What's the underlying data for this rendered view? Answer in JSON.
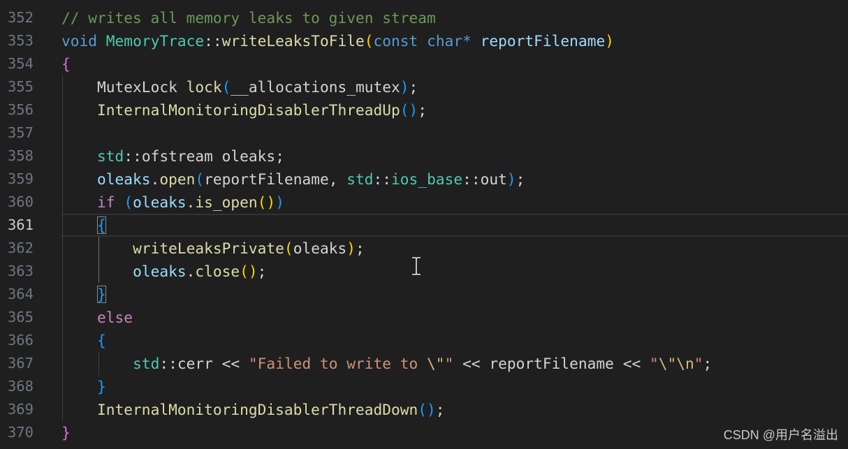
{
  "theme": {
    "background": "#1f1f1f",
    "colors": {
      "comment": "#6a9955",
      "keyword": "#569cd6",
      "control": "#c586c0",
      "type": "#4ec9b0",
      "function": "#dcdcaa",
      "variable": "#9cdcfe",
      "string": "#ce9178",
      "escape": "#d7ba7d",
      "plain": "#d4d4d4",
      "bracket1": "#ffd700",
      "bracket2": "#da70d6",
      "bracket3": "#179fff",
      "linenum": "#6e7681",
      "linenum_active": "#cccccc"
    }
  },
  "editor": {
    "lines": [
      {
        "num": "352",
        "tokens": [
          [
            "// writes all memory leaks to given stream",
            "comment"
          ]
        ]
      },
      {
        "num": "353",
        "tokens": [
          [
            "void",
            "keyword"
          ],
          [
            " ",
            "plain"
          ],
          [
            "MemoryTrace",
            "type"
          ],
          [
            "::",
            "plain"
          ],
          [
            "writeLeaksToFile",
            "function"
          ],
          [
            "(",
            "bracket1"
          ],
          [
            "const",
            "keyword"
          ],
          [
            " ",
            "plain"
          ],
          [
            "char",
            "keyword"
          ],
          [
            "*",
            "keyword"
          ],
          [
            " ",
            "plain"
          ],
          [
            "reportFilename",
            "variable"
          ],
          [
            ")",
            "bracket1"
          ]
        ]
      },
      {
        "num": "354",
        "tokens": [
          [
            "{",
            "bracket2"
          ]
        ]
      },
      {
        "num": "355",
        "tokens": [
          [
            "    ",
            "plain"
          ],
          [
            "MutexLock",
            "plain"
          ],
          [
            " ",
            "plain"
          ],
          [
            "lock",
            "function"
          ],
          [
            "(",
            "bracket3"
          ],
          [
            "__allocations_mutex",
            "plain"
          ],
          [
            ")",
            "bracket3"
          ],
          [
            ";",
            "plain"
          ]
        ]
      },
      {
        "num": "356",
        "tokens": [
          [
            "    ",
            "plain"
          ],
          [
            "InternalMonitoringDisablerThreadUp",
            "function"
          ],
          [
            "()",
            "bracket3"
          ],
          [
            ";",
            "plain"
          ]
        ]
      },
      {
        "num": "357",
        "tokens": []
      },
      {
        "num": "358",
        "tokens": [
          [
            "    ",
            "plain"
          ],
          [
            "std",
            "type"
          ],
          [
            "::",
            "plain"
          ],
          [
            "ofstream",
            "plain"
          ],
          [
            " ",
            "plain"
          ],
          [
            "oleaks",
            "plain"
          ],
          [
            ";",
            "plain"
          ]
        ]
      },
      {
        "num": "359",
        "tokens": [
          [
            "    ",
            "plain"
          ],
          [
            "oleaks",
            "variable"
          ],
          [
            ".",
            "plain"
          ],
          [
            "open",
            "function"
          ],
          [
            "(",
            "bracket3"
          ],
          [
            "reportFilename",
            "plain"
          ],
          [
            ", ",
            "plain"
          ],
          [
            "std",
            "type"
          ],
          [
            "::",
            "plain"
          ],
          [
            "ios_base",
            "type"
          ],
          [
            "::",
            "plain"
          ],
          [
            "out",
            "plain"
          ],
          [
            ")",
            "bracket3"
          ],
          [
            ";",
            "plain"
          ]
        ]
      },
      {
        "num": "360",
        "tokens": [
          [
            "    ",
            "plain"
          ],
          [
            "if",
            "control"
          ],
          [
            " ",
            "plain"
          ],
          [
            "(",
            "bracket3"
          ],
          [
            "oleaks",
            "variable"
          ],
          [
            ".",
            "plain"
          ],
          [
            "is_open",
            "function"
          ],
          [
            "()",
            "bracket1"
          ],
          [
            ")",
            "bracket3"
          ]
        ]
      },
      {
        "num": "361",
        "current": true,
        "tokens": [
          [
            "    ",
            "plain"
          ],
          [
            "{",
            "bracket3",
            "boxed"
          ]
        ]
      },
      {
        "num": "362",
        "tokens": [
          [
            "        ",
            "plain"
          ],
          [
            "writeLeaksPrivate",
            "function"
          ],
          [
            "(",
            "bracket1"
          ],
          [
            "oleaks",
            "plain"
          ],
          [
            ")",
            "bracket1"
          ],
          [
            ";",
            "plain"
          ]
        ]
      },
      {
        "num": "363",
        "tokens": [
          [
            "        ",
            "plain"
          ],
          [
            "oleaks",
            "variable"
          ],
          [
            ".",
            "plain"
          ],
          [
            "close",
            "function"
          ],
          [
            "()",
            "bracket1"
          ],
          [
            ";",
            "plain"
          ]
        ]
      },
      {
        "num": "364",
        "tokens": [
          [
            "    ",
            "plain"
          ],
          [
            "}",
            "bracket3",
            "boxed"
          ]
        ]
      },
      {
        "num": "365",
        "tokens": [
          [
            "    ",
            "plain"
          ],
          [
            "else",
            "control"
          ]
        ]
      },
      {
        "num": "366",
        "tokens": [
          [
            "    ",
            "plain"
          ],
          [
            "{",
            "bracket3"
          ]
        ]
      },
      {
        "num": "367",
        "tokens": [
          [
            "        ",
            "plain"
          ],
          [
            "std",
            "type"
          ],
          [
            "::",
            "plain"
          ],
          [
            "cerr",
            "plain"
          ],
          [
            " << ",
            "plain"
          ],
          [
            "\"Failed to write to ",
            "string"
          ],
          [
            "\\\"",
            "escape"
          ],
          [
            "\"",
            "string"
          ],
          [
            " << ",
            "plain"
          ],
          [
            "reportFilename",
            "plain"
          ],
          [
            " << ",
            "plain"
          ],
          [
            "\"",
            "string"
          ],
          [
            "\\\"",
            "escape"
          ],
          [
            "\\n",
            "escape"
          ],
          [
            "\"",
            "string"
          ],
          [
            ";",
            "plain"
          ]
        ]
      },
      {
        "num": "368",
        "tokens": [
          [
            "    ",
            "plain"
          ],
          [
            "}",
            "bracket3"
          ]
        ]
      },
      {
        "num": "369",
        "tokens": [
          [
            "    ",
            "plain"
          ],
          [
            "InternalMonitoringDisablerThreadDown",
            "function"
          ],
          [
            "()",
            "bracket3"
          ],
          [
            ";",
            "plain"
          ]
        ]
      },
      {
        "num": "370",
        "tokens": [
          [
            "}",
            "bracket2"
          ]
        ]
      }
    ]
  },
  "watermark": "CSDN @用户名溢出"
}
